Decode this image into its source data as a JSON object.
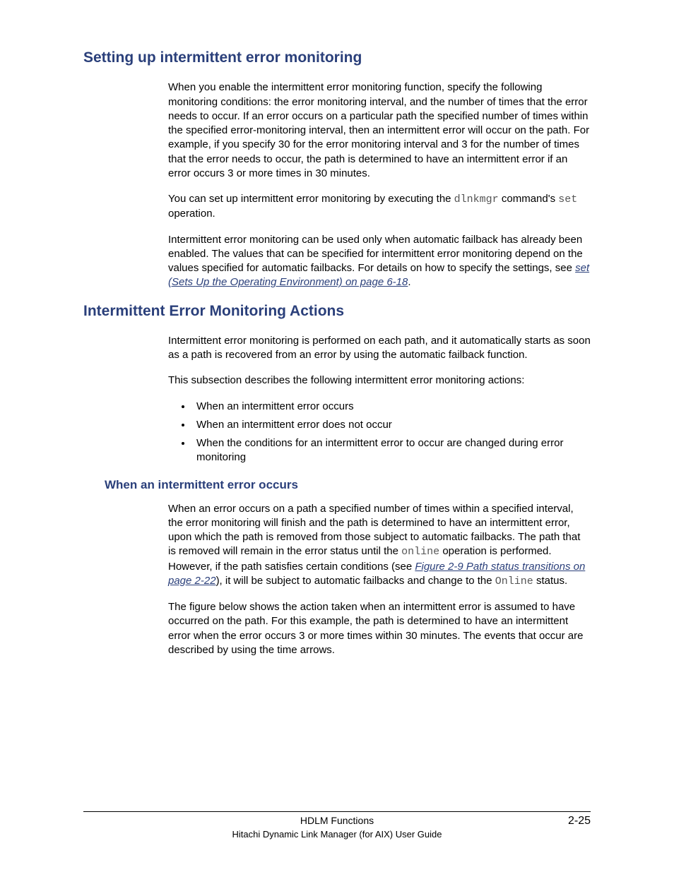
{
  "sections": {
    "s1_title": "Setting up intermittent error monitoring",
    "s1_p1": "When you enable the intermittent error monitoring function, specify the following monitoring conditions: the error monitoring interval, and the number of times that the error needs to occur. If an error occurs on a particular path the specified number of times within the specified error-monitoring interval, then an intermittent error will occur on the path. For example, if you specify 30 for the error monitoring interval and 3 for the number of times that the error needs to occur, the path is determined to have an intermittent error if an error occurs 3 or more times in 30 minutes.",
    "s1_p2_a": "You can set up intermittent error monitoring by executing the ",
    "s1_p2_mono1": "dlnkmgr",
    "s1_p2_b": " command's ",
    "s1_p2_mono2": "set",
    "s1_p2_c": " operation.",
    "s1_p3_a": "Intermittent error monitoring can be used only when automatic failback has already been enabled. The values that can be specified for intermittent error monitoring depend on the values specified for automatic failbacks. For details on how to specify the settings, see ",
    "s1_p3_link": "set (Sets Up the Operating Environment) on page 6-18",
    "s1_p3_b": ".",
    "s2_title": "Intermittent Error Monitoring Actions",
    "s2_p1": "Intermittent error monitoring is performed on each path, and it automatically starts as soon as a path is recovered from an error by using the automatic failback function.",
    "s2_p2": "This subsection describes the following intermittent error monitoring actions:",
    "s2_b1": "When an intermittent error occurs",
    "s2_b2": "When an intermittent error does not occur",
    "s2_b3": "When the conditions for an intermittent error to occur are changed during error monitoring",
    "s3_title": "When an intermittent error occurs",
    "s3_p1_a": "When an error occurs on a path a specified number of times within a specified interval, the error monitoring will finish and the path is determined to have an intermittent error, upon which the path is removed from those subject to automatic failbacks. The path that is removed will remain in the error status until the ",
    "s3_p1_mono1": "online",
    "s3_p1_b": " operation is performed. However, if the path satisfies certain conditions (see ",
    "s3_p1_link": "Figure 2-9 Path status transitions on page 2-22",
    "s3_p1_c": "), it will be subject to automatic failbacks and change to the ",
    "s3_p1_mono2": "Online",
    "s3_p1_d": " status.",
    "s3_p2": "The figure below shows the action taken when an intermittent error is assumed to have occurred on the path. For this example, the path is determined to have an intermittent error when the error occurs 3 or more times within 30 minutes. The events that occur are described by using the time arrows."
  },
  "footer": {
    "chapter": "HDLM Functions",
    "book": "Hitachi Dynamic Link Manager (for AIX) User Guide",
    "pageno": "2-25"
  }
}
